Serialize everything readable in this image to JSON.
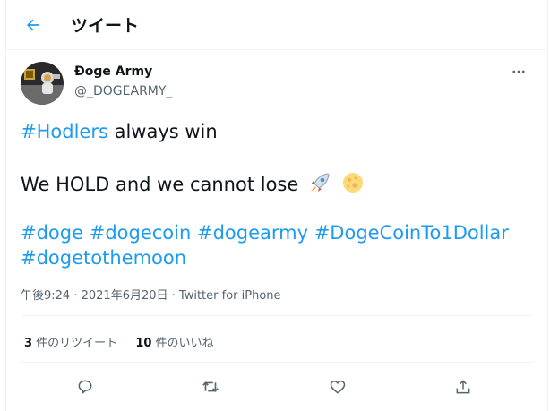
{
  "header": {
    "title": "ツイート"
  },
  "tweet": {
    "display_name": "Đoge Army",
    "handle": "@_DOGEARMY_",
    "line1_tag": "#Hodlers",
    "line1_text": " always win",
    "line2_text": "We HOLD and we cannot lose ",
    "hashtags_line1": [
      "#doge",
      "#dogecoin",
      "#dogearmy",
      "#DogeCoinTo1Dollar"
    ],
    "hashtags_line2": [
      "#dogetothemoon"
    ],
    "time": "午後9:24",
    "sep1": " · ",
    "date": "2021年6月20日",
    "sep2": " · ",
    "source": "Twitter for iPhone",
    "retweets_count": "3",
    "retweets_label": " 件のリツイート",
    "likes_count": "10",
    "likes_label": " 件のいいね"
  },
  "icons": {
    "back": "back-arrow-icon",
    "more": "more-dots-icon",
    "emoji1": "rocket-icon",
    "emoji2": "moon-icon",
    "reply": "reply-icon",
    "retweet": "retweet-icon",
    "like": "heart-icon",
    "share": "share-icon"
  },
  "colors": {
    "accent": "#1d9bf0",
    "text": "#0f1419",
    "muted": "#536471",
    "border": "#eff3f4"
  }
}
